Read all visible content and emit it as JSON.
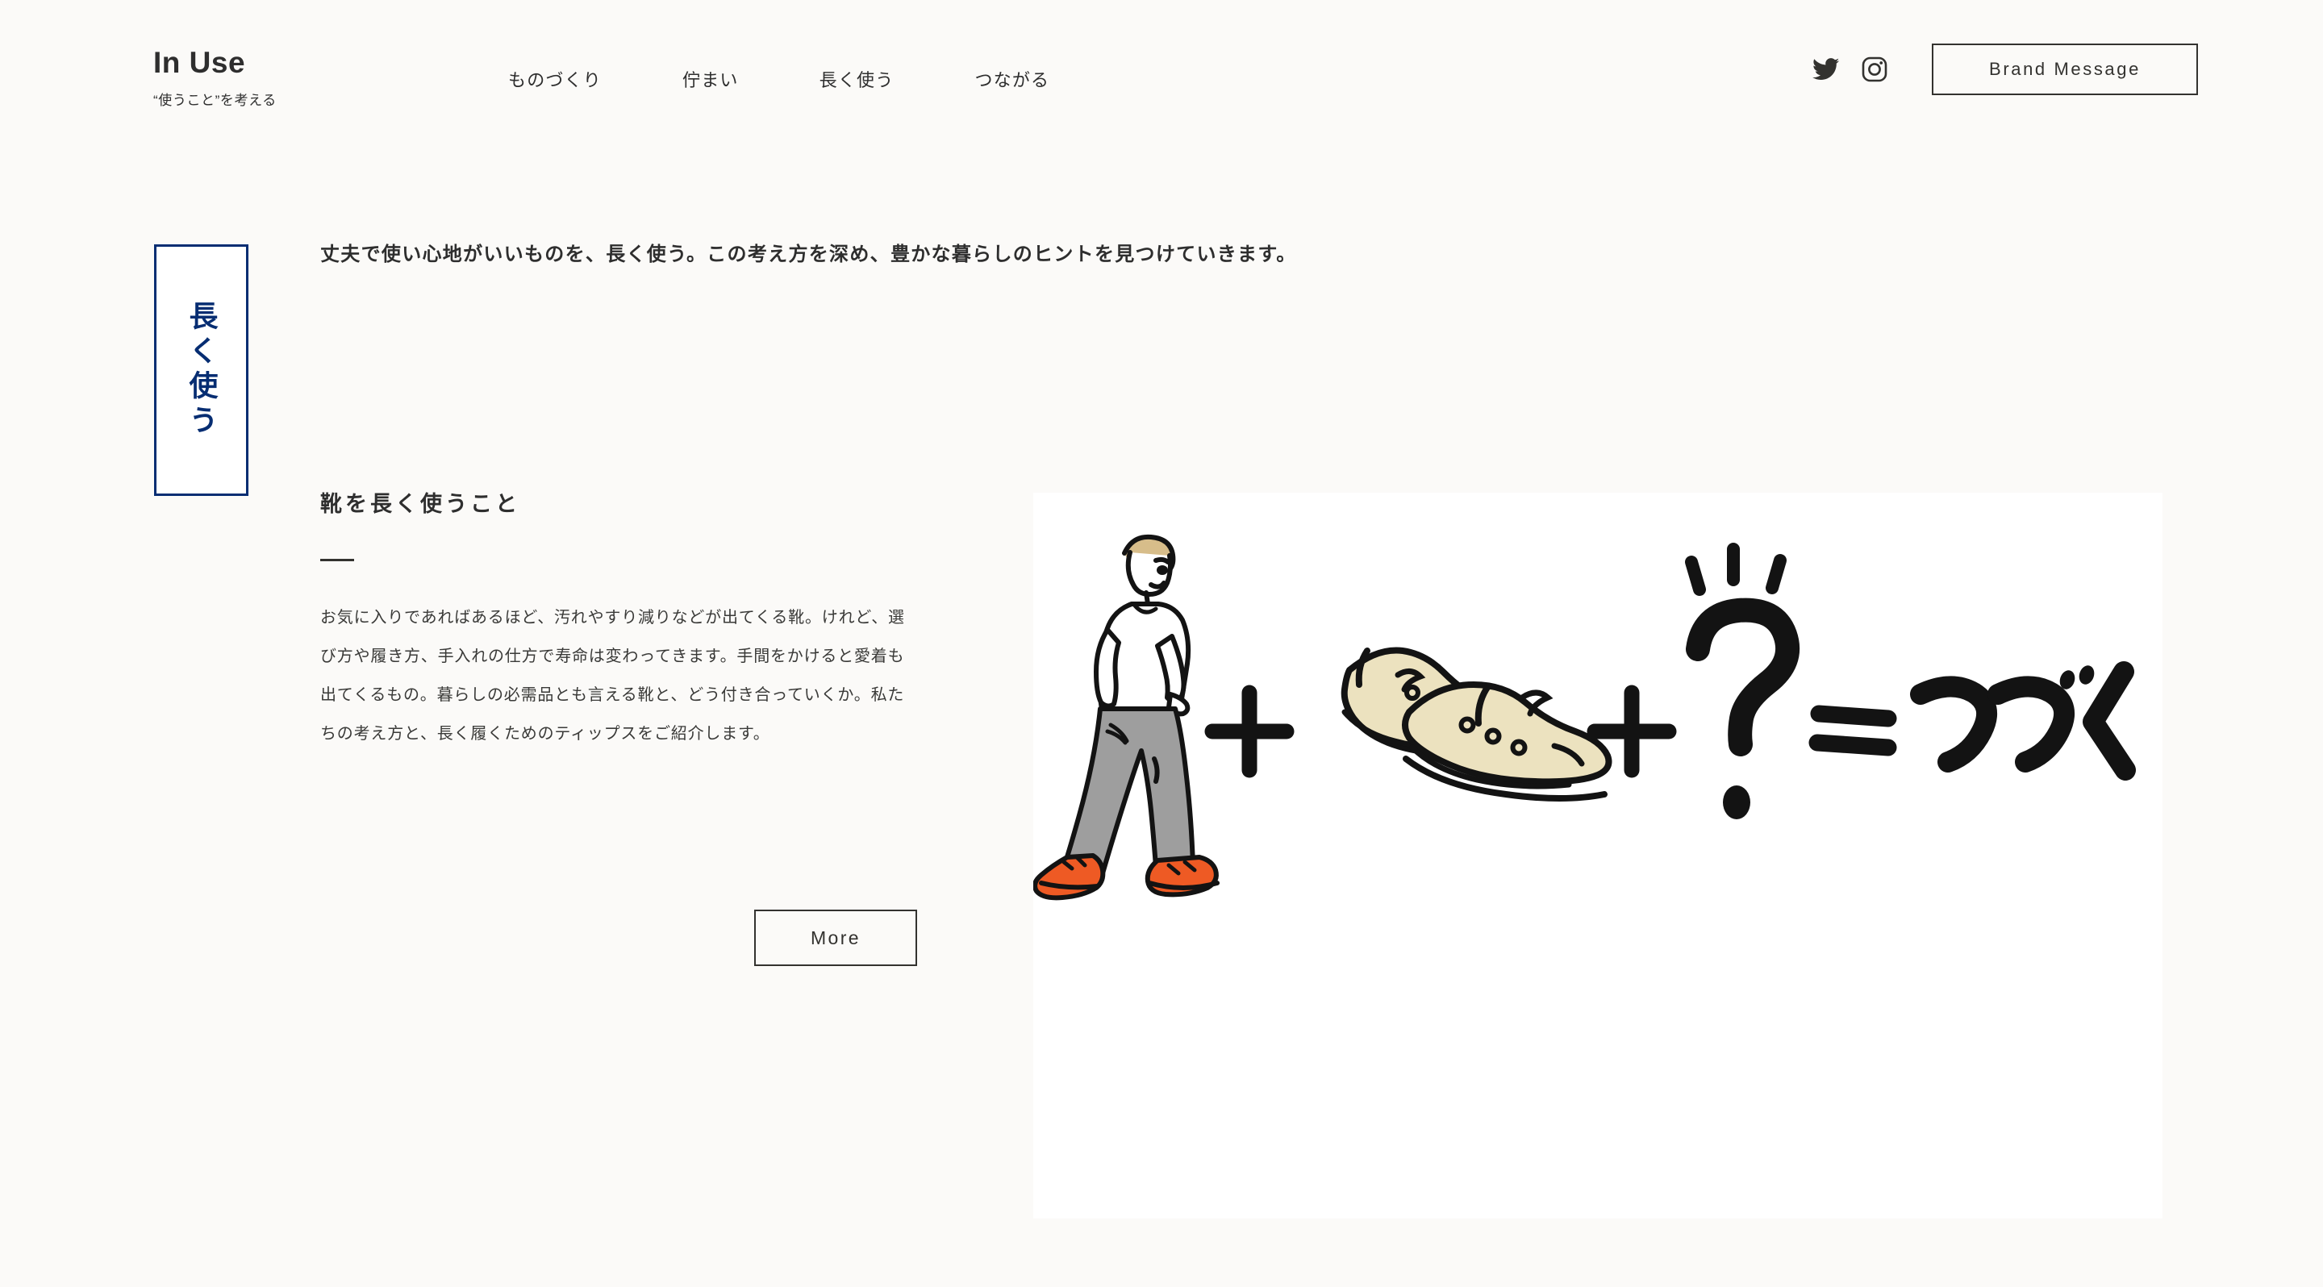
{
  "site": {
    "brand_name": "In Use",
    "brand_tagline": "“使うこと”を考える",
    "background_color": "#fbfaf8",
    "text_color": "#2e2e2e",
    "accent_color": "#062d72"
  },
  "nav": {
    "items": [
      {
        "label": "ものづくり"
      },
      {
        "label": "佇まい"
      },
      {
        "label": "長く使う"
      },
      {
        "label": "つながる"
      }
    ]
  },
  "header": {
    "social": [
      {
        "icon": "twitter-icon",
        "name": "Twitter"
      },
      {
        "icon": "instagram-icon",
        "name": "Instagram"
      }
    ],
    "brand_message_label": "Brand Message"
  },
  "category": {
    "label": "長く使う",
    "border_color": "#062d72",
    "text_color": "#062d72"
  },
  "lead": {
    "text": "丈夫で使い心地がいいものを、長く使う。この考え方を深め、豊かな暮らしのヒントを見つけていきます。"
  },
  "article": {
    "title": "靴を長く使うこと",
    "body": "お気に入りであればあるほど、汚れやすり減りなどが出てくる靴。けれど、選び方や履き方、手入れの仕方で寿命は変わってきます。手間をかけると愛着も出てくるもの。暮らしの必需品とも言える靴と、どう付き合っていくか。私たちの考え方と、長く履くためのティップスをご紹介します。",
    "more_label": "More"
  },
  "illustration": {
    "alt": "walking-person-plus-shoes-plus-question-equals-tsuzuku",
    "equation_text": "つづく",
    "plus_symbol": "+",
    "question_symbol": "?",
    "equals_symbol": "=",
    "colors": {
      "ink": "#131313",
      "shoe_cream": "#ece2bf",
      "pants_gray": "#9e9e9e",
      "sneaker_orange": "#ee5a24",
      "hair_tan": "#d7bd8a"
    }
  }
}
